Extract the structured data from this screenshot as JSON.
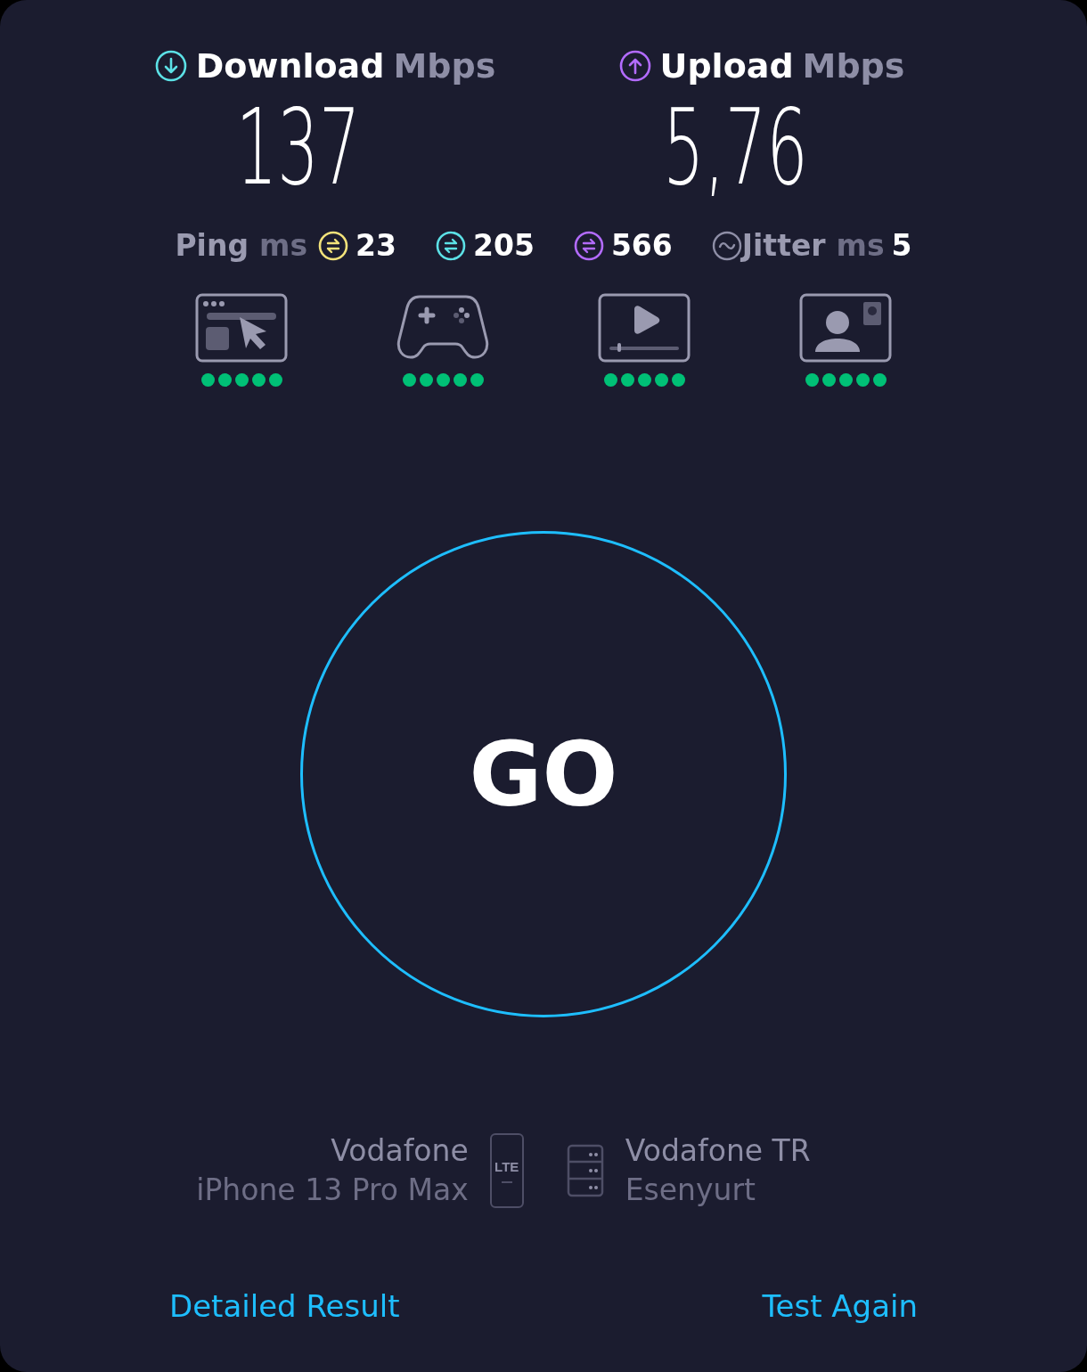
{
  "speeds": [
    {
      "kind": "download",
      "label": "Download",
      "unit": "Mbps",
      "value": "137"
    },
    {
      "kind": "upload",
      "label": "Upload",
      "unit": "Mbps",
      "value": "5,76"
    }
  ],
  "ping": {
    "label": "Ping",
    "unit": "ms",
    "values": [
      {
        "value": "23",
        "color": "#f2e27a"
      },
      {
        "value": "205",
        "color": "#5ce1e6"
      },
      {
        "value": "566",
        "color": "#b36bff"
      }
    ]
  },
  "jitter": {
    "label": "Jitter",
    "unit": "ms",
    "value": "5"
  },
  "activities": [
    {
      "kind": "browsing",
      "stars": 5
    },
    {
      "kind": "gaming",
      "stars": 5
    },
    {
      "kind": "video",
      "stars": 5
    },
    {
      "kind": "call",
      "stars": 5
    }
  ],
  "go_button": {
    "label": "GO"
  },
  "provider": {
    "name": "Vodafone",
    "device": "iPhone 13 Pro Max",
    "network_badge": "LTE"
  },
  "server": {
    "name": "Vodafone TR",
    "location": "Esenyurt"
  },
  "links": [
    "Detailed Result",
    "Test Again"
  ]
}
